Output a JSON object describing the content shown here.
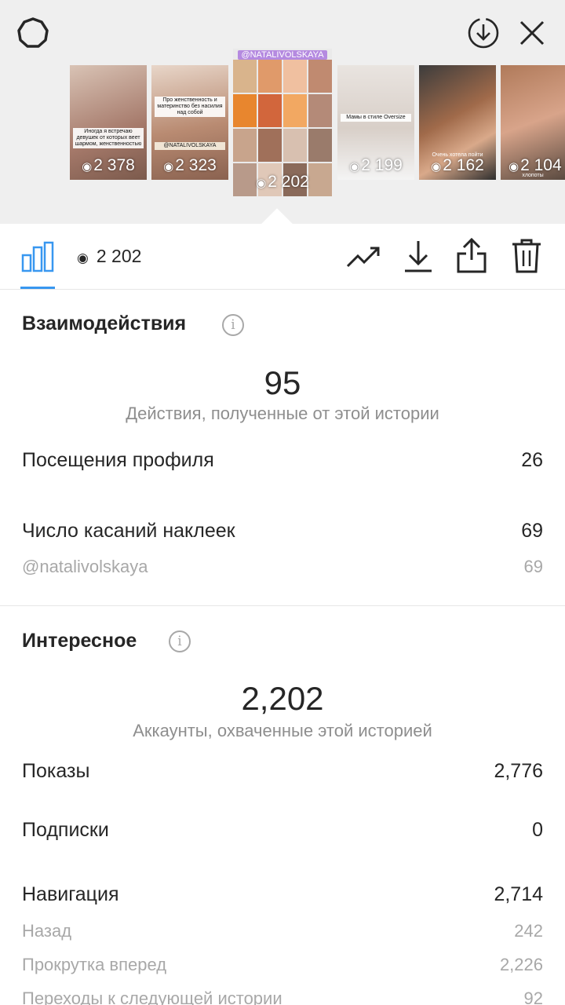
{
  "header": {
    "icons": [
      "gear-icon",
      "download-circle-icon",
      "close-icon"
    ]
  },
  "stories": [
    {
      "views": "2 378",
      "caption": "Иногда я встречаю девушек от которых веет шармом, женственностью"
    },
    {
      "views": "2 323",
      "caption": "Про женственность и материнство без насилия над собой",
      "tag": "@NATALIVOLSKAYA"
    },
    {
      "views": "2 202",
      "tag": "@NATALIVOLSKAYA",
      "active": true
    },
    {
      "views": "2 199",
      "caption": "Мамы в стиле Oversize"
    },
    {
      "views": "2 162",
      "caption": "Очень хотела пойти"
    },
    {
      "views": "2 104",
      "caption": "хлопоты"
    }
  ],
  "toolbar": {
    "views": "2 202",
    "icons": [
      "bar-chart-icon",
      "eye-icon",
      "trending-icon",
      "download-icon",
      "share-icon",
      "trash-icon"
    ]
  },
  "interactions": {
    "title": "Взаимодействия",
    "total": "95",
    "total_label": "Действия, полученные от этой истории",
    "rows": [
      {
        "label": "Посещения профиля",
        "value": "26"
      },
      {
        "label": "Число касаний наклеек",
        "value": "69"
      },
      {
        "label": "@natalivolskaya",
        "value": "69"
      }
    ]
  },
  "discovery": {
    "title": "Интересное",
    "total": "2,202",
    "total_label": "Аккаунты, охваченные этой историей",
    "rows": [
      {
        "label": "Показы",
        "value": "2,776"
      },
      {
        "label": "Подписки",
        "value": "0"
      },
      {
        "label": "Навигация",
        "value": "2,714"
      },
      {
        "label": "Назад",
        "value": "242"
      },
      {
        "label": "Прокрутка вперед",
        "value": "2,226"
      },
      {
        "label": "Переходы к следующей истории",
        "value": "92"
      }
    ]
  },
  "colors": {
    "accent": "#3897f0",
    "text": "#262626",
    "muted": "#8e8e8e"
  }
}
